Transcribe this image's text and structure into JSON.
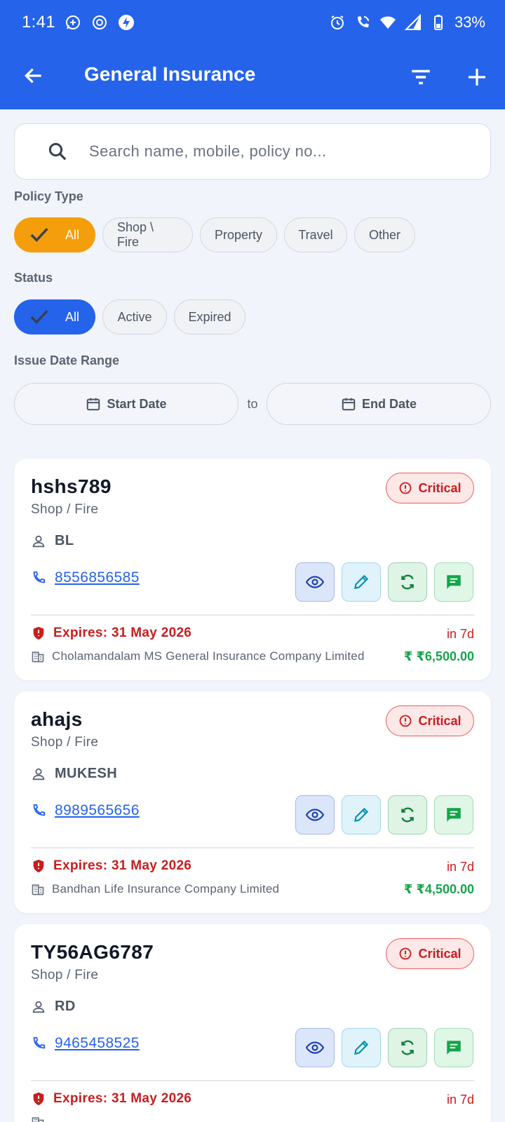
{
  "status_bar": {
    "time": "1:41",
    "battery": "33%"
  },
  "app_bar": {
    "title": "General Insurance"
  },
  "search": {
    "placeholder": "Search name, mobile, policy no..."
  },
  "filters": {
    "policy_type_label": "Policy Type",
    "policy_types": [
      "All",
      "Shop \\ Fire",
      "Property",
      "Travel",
      "Other"
    ],
    "status_label": "Status",
    "statuses": [
      "All",
      "Active",
      "Expired"
    ],
    "date_range_label": "Issue Date Range",
    "start_date": "Start Date",
    "to": "to",
    "end_date": "End Date"
  },
  "colors": {
    "primary": "#2563eb",
    "selected_type_chip": "#f59e0b",
    "critical": "#c81e1e",
    "amount": "#16a34a"
  },
  "policies": [
    {
      "policy_no": "hshs789",
      "type": "Shop / Fire",
      "badge": "Critical",
      "holder": "BL",
      "phone": "8556856585",
      "expires": "Expires: 31 May 2026",
      "in_days": "in 7d",
      "company": "Cholamandalam MS General Insurance Company Limited",
      "amount": "₹ ₹6,500.00"
    },
    {
      "policy_no": "ahajs",
      "type": "Shop / Fire",
      "badge": "Critical",
      "holder": "MUKESH",
      "phone": "8989565656",
      "expires": "Expires: 31 May 2026",
      "in_days": "in 7d",
      "company": "Bandhan Life Insurance Company Limited",
      "amount": "₹ ₹4,500.00"
    },
    {
      "policy_no": "TY56AG6787",
      "type": "Shop / Fire",
      "badge": "Critical",
      "holder": "RD",
      "phone": "9465458525",
      "expires": "Expires: 31 May 2026",
      "in_days": "in 7d",
      "company": "",
      "amount": ""
    }
  ]
}
